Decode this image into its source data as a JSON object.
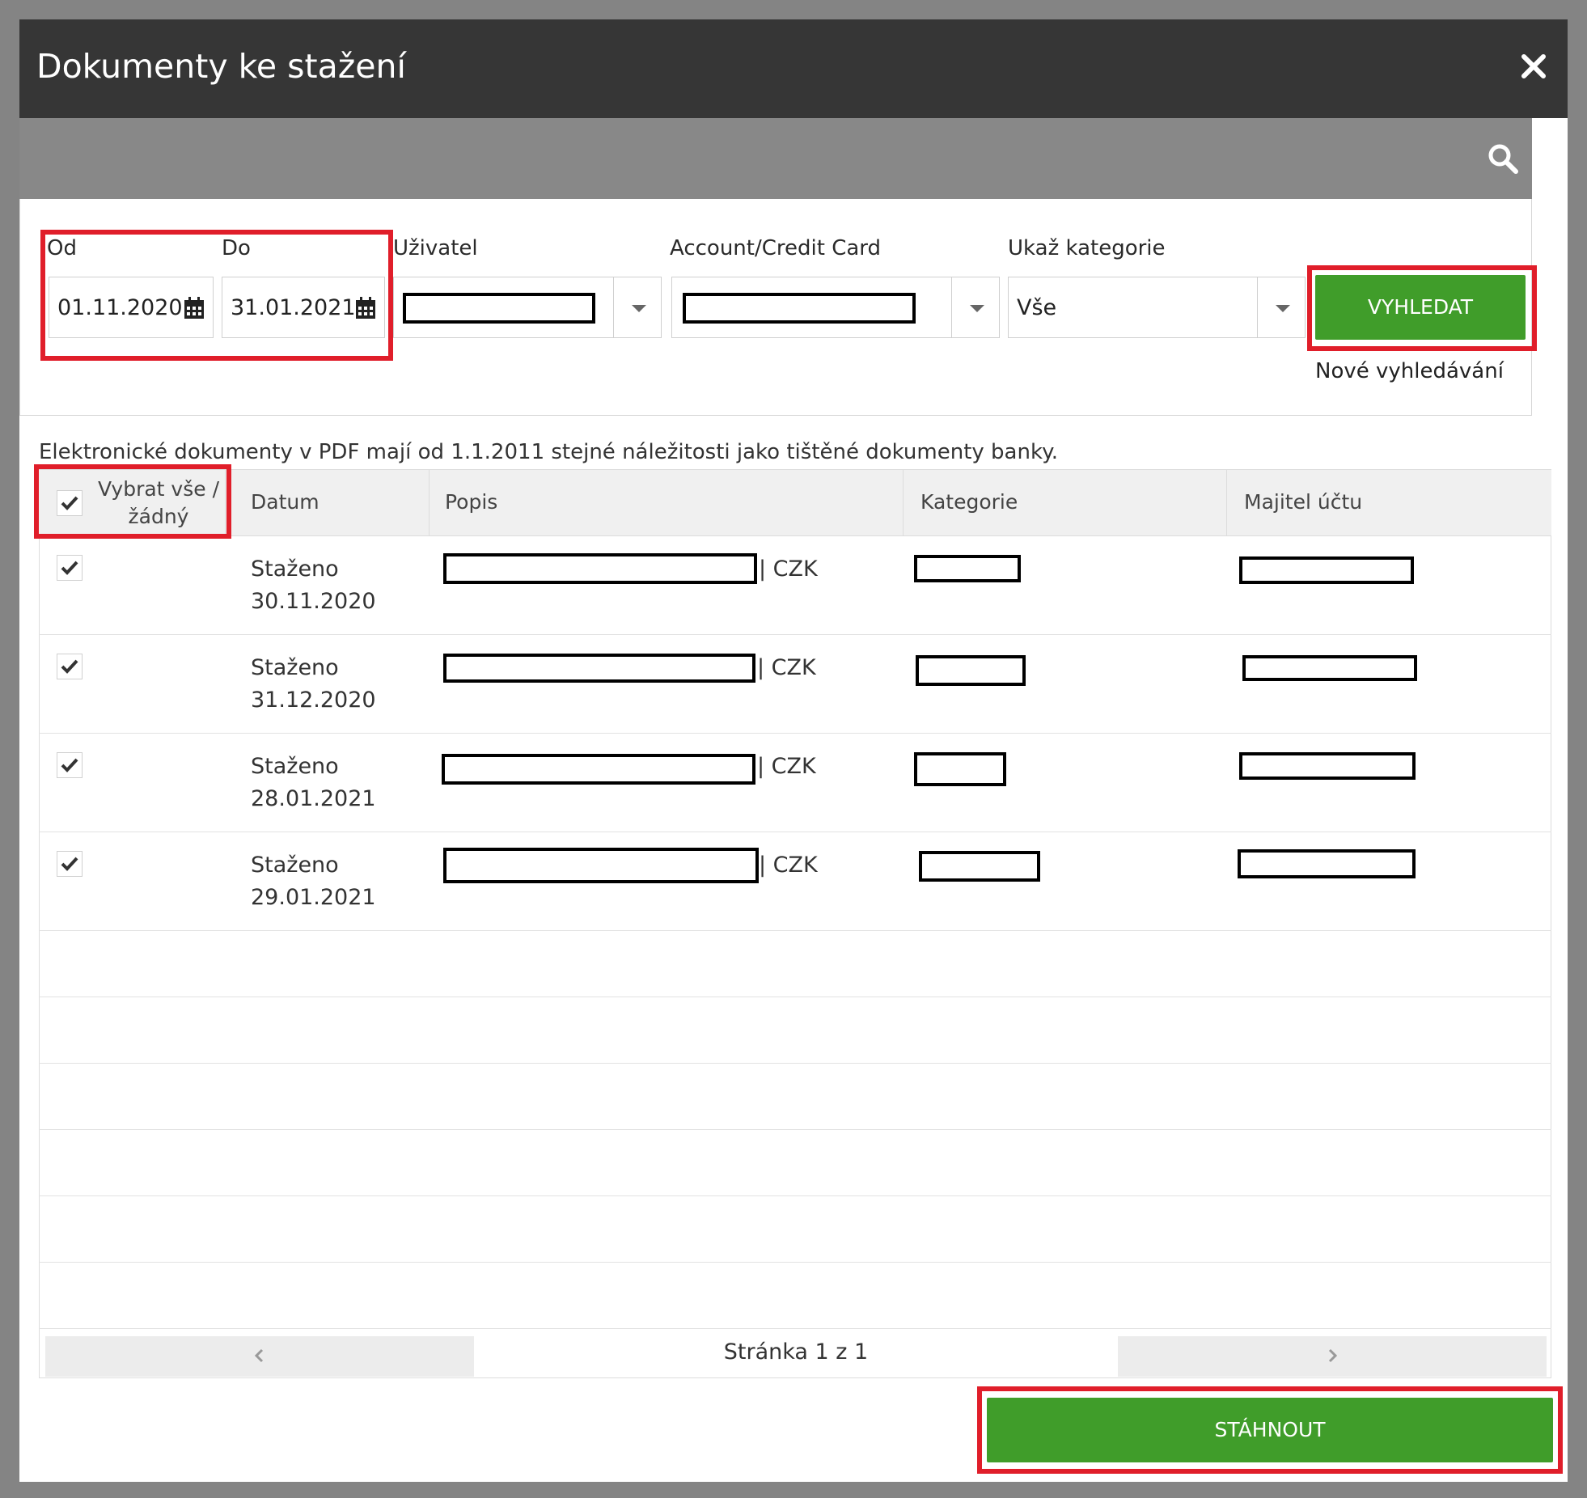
{
  "dialog": {
    "title": "Dokumenty ke stažení"
  },
  "filters": {
    "od_label": "Od",
    "od_value": "01.11.2020",
    "do_label": "Do",
    "do_value": "31.01.2021",
    "uzivatel_label": "Uživatel",
    "account_label": "Account/Credit Card",
    "kategorie_label": "Ukaž kategorie",
    "kategorie_value": "Vše",
    "search_button": "VYHLEDAT",
    "new_search_link": "Nové vyhledávání"
  },
  "note": "Elektronické dokumenty v PDF mají od 1.1.2011 stejné náležitosti jako tištěné dokumenty banky.",
  "table": {
    "headers": {
      "select_all_line1": "Vybrat vše /",
      "select_all_line2": "žádný",
      "datum": "Datum",
      "popis": "Popis",
      "kategorie": "Kategorie",
      "majitel": "Majitel účtu"
    },
    "rows": [
      {
        "status": "Staženo",
        "date": "30.11.2020",
        "currency": "| CZK",
        "checked": true
      },
      {
        "status": "Staženo",
        "date": "31.12.2020",
        "currency": "| CZK",
        "checked": true
      },
      {
        "status": "Staženo",
        "date": "28.01.2021",
        "currency": "| CZK",
        "checked": true
      },
      {
        "status": "Staženo",
        "date": "29.01.2021",
        "currency": "| CZK",
        "checked": true
      }
    ]
  },
  "pager": {
    "info": "Stránka 1 z 1"
  },
  "download_button": "STÁHNOUT",
  "colors": {
    "green": "#409d2a",
    "highlight": "#e01e2a",
    "titlebar": "#363636"
  }
}
